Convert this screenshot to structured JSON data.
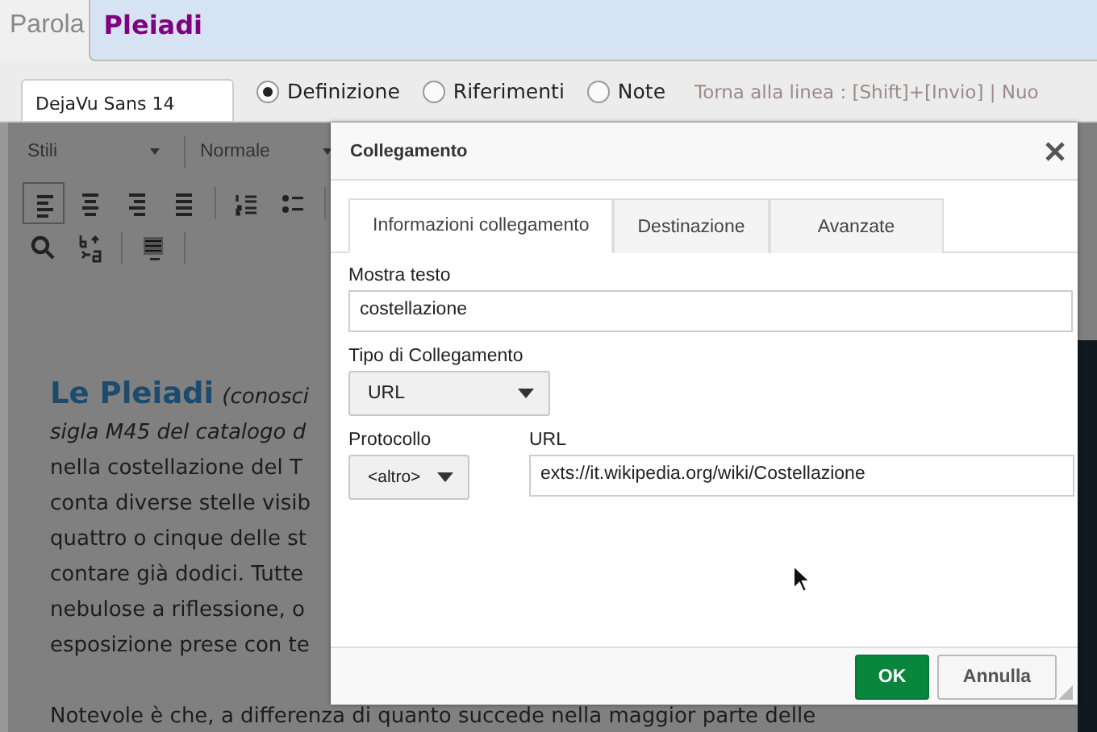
{
  "top_bar": {
    "label": "Parola",
    "title": "Pleiadi"
  },
  "options_bar": {
    "font_field": "DejaVu Sans 14",
    "radios": [
      {
        "label": "Definizione",
        "selected": true
      },
      {
        "label": "Riferimenti",
        "selected": false
      },
      {
        "label": "Note",
        "selected": false
      }
    ],
    "hint": "Torna alla linea : [Shift]+[Invio] | Nuo"
  },
  "editor": {
    "dropdowns": [
      "Stili",
      "Normale"
    ],
    "heading": "Le Pleiadi",
    "heading_note": "(conosci",
    "lines": [
      {
        "text": "sigla M45 del catalogo d",
        "italic": true
      },
      {
        "text": "nella costellazione del T",
        "italic": false
      },
      {
        "text": "conta diverse stelle visib",
        "italic": false
      },
      {
        "text": "quattro o cinque delle st",
        "italic": false
      },
      {
        "text": "contare già dodici. Tutte",
        "italic": false
      },
      {
        "text": "nebulose a riflessione, o",
        "italic": false
      },
      {
        "text": "esposizione prese con te",
        "italic": false
      }
    ],
    "last_line": "Notevole è che, a differenza di quanto succede nella maggior parte delle"
  },
  "dialog": {
    "title": "Collegamento",
    "tabs": [
      {
        "label": "Informazioni collegamento",
        "selected": true
      },
      {
        "label": "Destinazione",
        "selected": false
      },
      {
        "label": "Avanzate",
        "selected": false
      }
    ],
    "fields": [
      {
        "kind": "text",
        "label": "Mostra testo",
        "value": "costellazione"
      },
      {
        "kind": "select",
        "label": "Tipo di Collegamento",
        "value": "URL"
      }
    ],
    "protocol": {
      "label": "Protocollo",
      "value": "<altro>"
    },
    "url": {
      "label": "URL",
      "value": "exts://it.wikipedia.org/wiki/Costellazione"
    },
    "buttons": [
      {
        "label": "OK",
        "kind": "primary"
      },
      {
        "label": "Annulla",
        "kind": "secondary"
      }
    ]
  }
}
